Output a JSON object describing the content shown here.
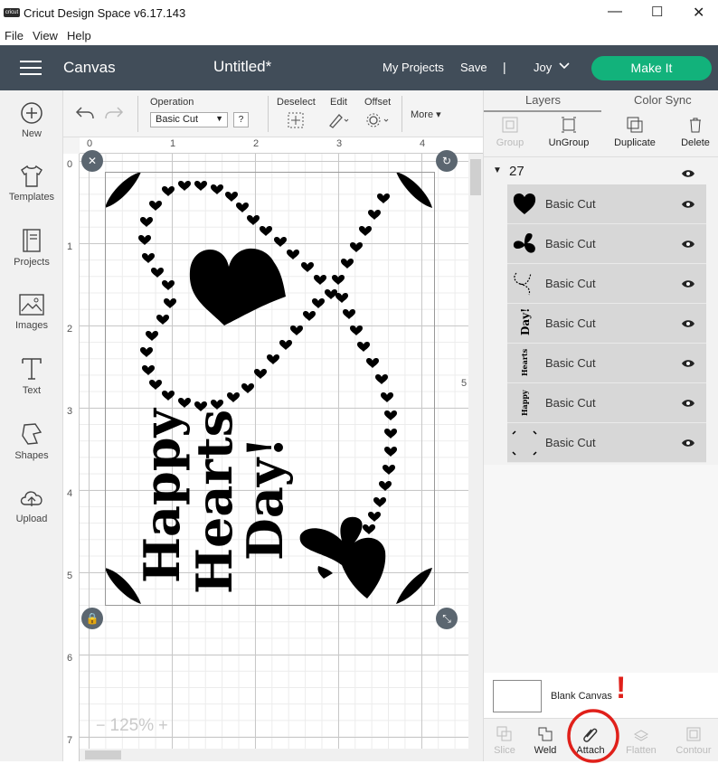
{
  "window": {
    "app_icon": "cricut",
    "title": "Cricut Design Space  v6.17.143",
    "minimize": "—",
    "maximize": "☐",
    "close": "✕"
  },
  "menu": [
    "File",
    "View",
    "Help"
  ],
  "header": {
    "section": "Canvas",
    "project_name": "Untitled*",
    "my_projects": "My Projects",
    "save": "Save",
    "separator": "|",
    "user": "Joy",
    "make_it": "Make It"
  },
  "sidebar": [
    {
      "label": "New",
      "icon": "plus-circle-icon"
    },
    {
      "label": "Templates",
      "icon": "tshirt-icon"
    },
    {
      "label": "Projects",
      "icon": "book-icon"
    },
    {
      "label": "Images",
      "icon": "image-icon"
    },
    {
      "label": "Text",
      "icon": "text-t-icon"
    },
    {
      "label": "Shapes",
      "icon": "shapes-icon"
    },
    {
      "label": "Upload",
      "icon": "cloud-upload-icon"
    }
  ],
  "toolbar": {
    "operation_label": "Operation",
    "operation_value": "Basic Cut",
    "help": "?",
    "deselect": "Deselect",
    "edit": "Edit",
    "offset": "Offset",
    "more": "More"
  },
  "ruler": {
    "top": [
      "0",
      "1",
      "2",
      "3",
      "4"
    ],
    "left": [
      "0",
      "1",
      "2",
      "3",
      "4",
      "5",
      "6",
      "7"
    ],
    "right_marker": "5"
  },
  "canvas": {
    "text_lines": [
      "Happy",
      "Hearts",
      "Day!"
    ],
    "zoom": "125%",
    "zoom_minus": "−",
    "zoom_plus": "+"
  },
  "right_panel": {
    "tabs": [
      "Layers",
      "Color Sync"
    ],
    "tools": [
      "Group",
      "UnGroup",
      "Duplicate",
      "Delete"
    ],
    "group_name": "27",
    "layers": [
      {
        "label": "Basic Cut",
        "thumb": "heart"
      },
      {
        "label": "Basic Cut",
        "thumb": "butterfly"
      },
      {
        "label": "Basic Cut",
        "thumb": "heart-path"
      },
      {
        "label": "Basic Cut",
        "thumb": "Day!"
      },
      {
        "label": "Basic Cut",
        "thumb": "Hearts"
      },
      {
        "label": "Basic Cut",
        "thumb": "Happy"
      },
      {
        "label": "Basic Cut",
        "thumb": "corners"
      }
    ],
    "blank_canvas": "Blank Canvas",
    "bottom_tools": [
      "Slice",
      "Weld",
      "Attach",
      "Flatten",
      "Contour"
    ],
    "annotation": "!"
  }
}
